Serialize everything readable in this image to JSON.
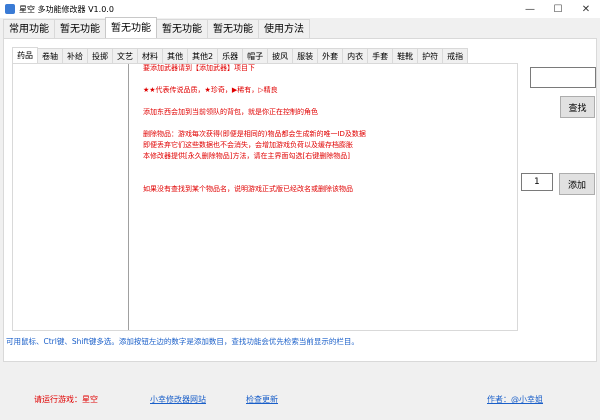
{
  "window": {
    "title": "星空 多功能修改器 V1.0.0",
    "minimize": "—",
    "maximize": "☐",
    "close": "✕"
  },
  "main_tabs": [
    "常用功能",
    "暂无功能",
    "暂无功能",
    "暂无功能",
    "暂无功能",
    "使用方法"
  ],
  "main_tabs_active": 2,
  "sub_tabs": [
    "药品",
    "卷轴",
    "补给",
    "投掷",
    "文艺",
    "材料",
    "其他",
    "其他2",
    "乐器",
    "帽子",
    "披风",
    "服装",
    "外套",
    "内衣",
    "手套",
    "鞋靴",
    "护符",
    "戒指"
  ],
  "sub_tabs_active": 0,
  "info_lines": [
    "要添加武器请到【添加武器】项目下",
    "",
    "★★代表传说品质，★珍奇，▶稀有，▷精良",
    "",
    "添加东西会加到当前领队的背包，就是你正在控制的角色",
    "",
    "删除物品：游戏每次获得(即便是相同的)物品都会生成新的唯一ID及数据",
    "即便丢弃它们这些数据也不会消失，会增加游戏负荷以及缓存档膨胀",
    "本修改器提供[永久删除物品]方法，请在主界面勾选[右键删除物品]",
    "",
    "",
    "如果没有查找到某个物品名，说明游戏正式版已经改名或删除该物品"
  ],
  "search": {
    "value": "",
    "button_label": "查找"
  },
  "add": {
    "quantity": "1",
    "button_label": "添加"
  },
  "hint": "可用鼠标、Ctrl键、Shift键多选。添加按钮左边的数字是添加数目，查找功能会优先检索当前显示的栏目。",
  "footer": {
    "run_game": "请运行游戏：星空",
    "site_link": "小幸修改器网站",
    "update_link": "检查更新",
    "author": "作者：@小幸姐"
  },
  "colors": {
    "accent_red": "#e00000",
    "link_blue": "#1a5fc9"
  }
}
